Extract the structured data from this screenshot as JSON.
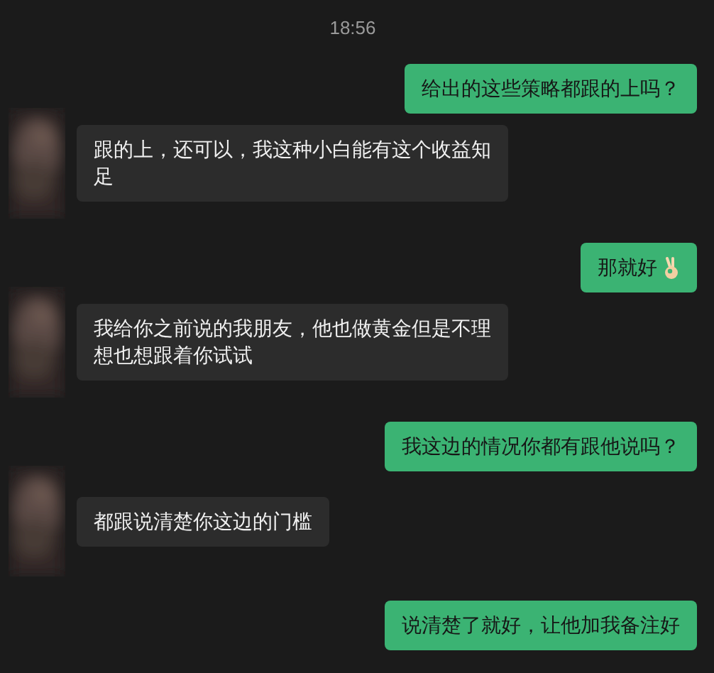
{
  "timestamp": "18:56",
  "messages": [
    {
      "kind": "sent",
      "text": "给出的这些策略都跟的上吗？"
    },
    {
      "kind": "received",
      "text": "跟的上，还可以，我这种小白能有这个收益知足"
    },
    {
      "kind": "sent",
      "text": "那就好",
      "emoji": true
    },
    {
      "kind": "received",
      "text": "我给你之前说的我朋友，他也做黄金但是不理想也想跟着你试试"
    },
    {
      "kind": "sent",
      "text": "我这边的情况你都有跟他说吗？"
    },
    {
      "kind": "received",
      "text": "都跟说清楚你这边的门槛"
    },
    {
      "kind": "sent",
      "text": "说清楚了就好，让他加我备注好"
    }
  ]
}
